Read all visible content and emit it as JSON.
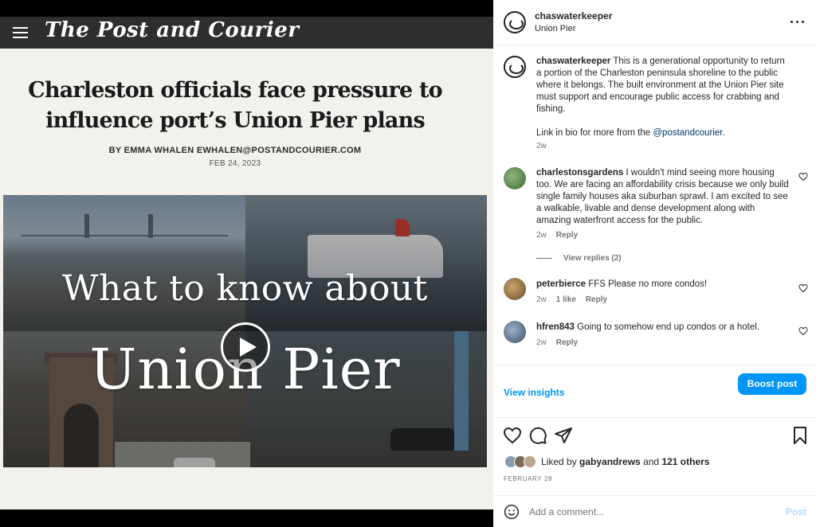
{
  "media": {
    "masthead": "The Post and Courier",
    "headline": "Charleston officials face pressure to influence port’s Union Pier plans",
    "byline": "BY EMMA WHALEN EWHALEN@POSTANDCOURIER.COM",
    "date": "FEB 24, 2023",
    "video_title_line1": "What to know about",
    "video_title_line2": "Union Pier"
  },
  "header": {
    "username": "chaswaterkeeper",
    "location": "Union Pier"
  },
  "caption": {
    "username": "chaswaterkeeper",
    "text": "This is a generational opportunity to return a portion of the Charleston peninsula shoreline to the public where it belongs. The built environment at the Union Pier site must support and encourage public access for crabbing and fishing.",
    "text2": "Link in bio for more from the ",
    "mention": "@postandcourier",
    "text2_end": ".",
    "time": "2w"
  },
  "comments": [
    {
      "username": "charlestonsgardens",
      "text": "I wouldn't mind seeing more housing too. We are facing an affordability crisis because we only build single family houses aka suburban sprawl. I am excited to see a walkable, livable and dense development along with amazing waterfront access for the public.",
      "time": "2w",
      "likes": "",
      "reply": "Reply",
      "view_replies": "View replies (2)"
    },
    {
      "username": "peterbierce",
      "text": "FFS Please no more condos!",
      "time": "2w",
      "likes": "1 like",
      "reply": "Reply"
    },
    {
      "username": "hfren843",
      "text": "Going to somehow end up condos or a hotel.",
      "time": "2w",
      "likes": "",
      "reply": "Reply"
    }
  ],
  "insights": {
    "view_label": "View insights",
    "boost_label": "Boost post"
  },
  "likes": {
    "prefix": "Liked by ",
    "user": "gabyandrews",
    "middle": " and ",
    "others": "121 others"
  },
  "post_date": "FEBRUARY 28",
  "add_comment": {
    "placeholder": "Add a comment...",
    "post_label": "Post"
  },
  "icons": {
    "like": "heart-icon",
    "comment": "comment-icon",
    "share": "send-icon",
    "save": "bookmark-icon",
    "emoji": "emoji-icon",
    "more": "more-icon",
    "play": "play-icon",
    "menu": "hamburger-icon"
  },
  "colors": {
    "accent": "#0095f6",
    "link": "#00376b",
    "muted": "#737373",
    "masthead_bg": "#2e2f2c"
  }
}
